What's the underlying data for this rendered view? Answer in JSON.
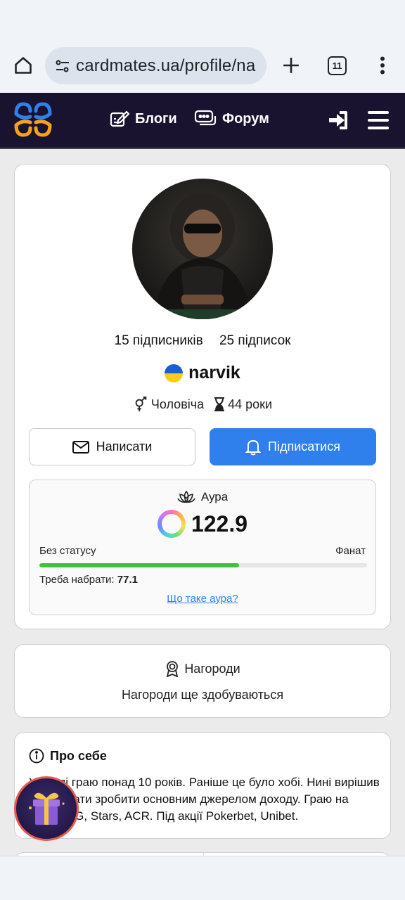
{
  "browser": {
    "url": "cardmates.ua/profile/na",
    "tab_count": "11",
    "icons": [
      "home-icon",
      "tune-icon",
      "plus-icon",
      "tabs-icon",
      "more-vert-icon"
    ]
  },
  "header": {
    "nav": [
      {
        "label": "Блоги",
        "icon": "blog-edit-icon"
      },
      {
        "label": "Форум",
        "icon": "chat-icon"
      }
    ],
    "icons": [
      "login-icon",
      "hamburger-icon"
    ],
    "colors": {
      "bg": "#1a1330",
      "logo_blue": "#2f80ed",
      "logo_orange": "#f7a21b"
    }
  },
  "profile": {
    "followers": "15 підписників",
    "following": "25 підписок",
    "username": "narvik",
    "gender": "Чоловіча",
    "age": "44 роки",
    "write_label": "Написати",
    "follow_label": "Підписатися"
  },
  "aura": {
    "title": "Аура",
    "value": "122.9",
    "level_from": "Без статусу",
    "level_to": "Фанат",
    "progress_fraction": 0.61,
    "need_label": "Треба набрати:",
    "need_value": "77.1",
    "link": "Що таке аура?"
  },
  "awards": {
    "title": "Нагороди",
    "text": "Нагороди ще здобуваються"
  },
  "about": {
    "title": "Про себе",
    "text": "Узагалі граю понад 10 років. Раніше це було хобі. Нині вирішив спробувати зробити основним джерелом доходу. Граю на румах GG, Stars, ACR. Під акції Pokerbet, Unibet."
  },
  "colors": {
    "primary": "#2f80ed",
    "progress": "#3cc23c"
  }
}
